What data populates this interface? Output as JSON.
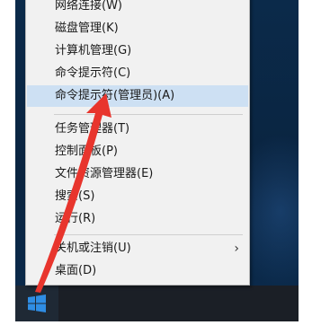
{
  "menu": {
    "items": [
      {
        "label": "网络连接(W)"
      },
      {
        "label": "磁盘管理(K)"
      },
      {
        "label": "计算机管理(G)"
      },
      {
        "label": "命令提示符(C)"
      },
      {
        "label": "命令提示符(管理员)(A)"
      },
      {
        "label": "任务管理器(T)"
      },
      {
        "label": "控制面板(P)"
      },
      {
        "label": "文件资源管理器(E)"
      },
      {
        "label": "搜索(S)"
      },
      {
        "label": "运行(R)"
      },
      {
        "label": "关机或注销(U)",
        "chevron": "›"
      },
      {
        "label": "桌面(D)"
      }
    ]
  },
  "icons": {
    "start": "windows-logo-icon",
    "submenu": "chevron-right-icon",
    "annotation": "red-arrow-annotation"
  },
  "colors": {
    "menu_background": "#f1f1f1",
    "selected_item": "#cde0f3",
    "desktop": "#0a2440",
    "taskbar": "#1b1f26",
    "start_logo": "#2f8de4",
    "arrow": "#e8352d"
  }
}
